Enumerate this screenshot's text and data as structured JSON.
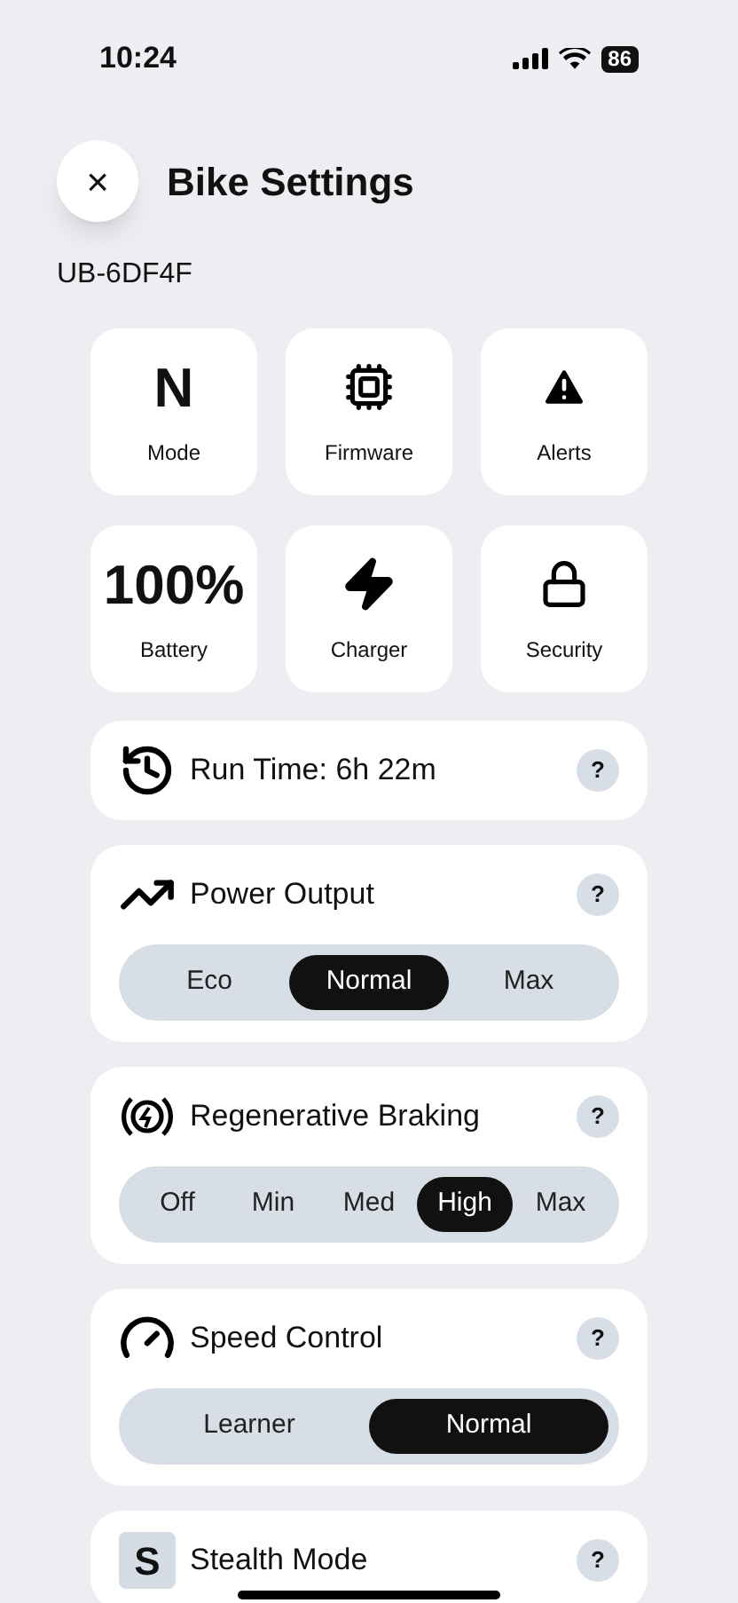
{
  "status_bar": {
    "time": "10:24",
    "battery": "86"
  },
  "header": {
    "close": "×",
    "title": "Bike Settings"
  },
  "device_id": "UB-6DF4F",
  "tiles": [
    {
      "kind": "value",
      "value": "N",
      "label": "Mode"
    },
    {
      "kind": "icon",
      "label": "Firmware"
    },
    {
      "kind": "icon",
      "label": "Alerts"
    },
    {
      "kind": "value",
      "value": "100%",
      "label": "Battery"
    },
    {
      "kind": "icon",
      "label": "Charger"
    },
    {
      "kind": "icon",
      "label": "Security"
    }
  ],
  "sections": [
    {
      "kind": "info",
      "title": "Run Time: 6h 22m",
      "help": "?"
    },
    {
      "kind": "segmented",
      "title": "Power Output",
      "help": "?",
      "options": [
        {
          "label": "Eco",
          "selected": false
        },
        {
          "label": "Normal",
          "selected": true
        },
        {
          "label": "Max",
          "selected": false
        }
      ]
    },
    {
      "kind": "segmented",
      "title": "Regenerative Braking",
      "help": "?",
      "options": [
        {
          "label": "Off",
          "selected": false
        },
        {
          "label": "Min",
          "selected": false
        },
        {
          "label": "Med",
          "selected": false
        },
        {
          "label": "High",
          "selected": true
        },
        {
          "label": "Max",
          "selected": false
        }
      ]
    },
    {
      "kind": "segmented",
      "title": "Speed Control",
      "help": "?",
      "options": [
        {
          "label": "Learner",
          "selected": false
        },
        {
          "label": "Normal",
          "selected": true
        }
      ]
    },
    {
      "kind": "letter",
      "badge": "S",
      "title": "Stealth Mode",
      "help": "?"
    }
  ]
}
